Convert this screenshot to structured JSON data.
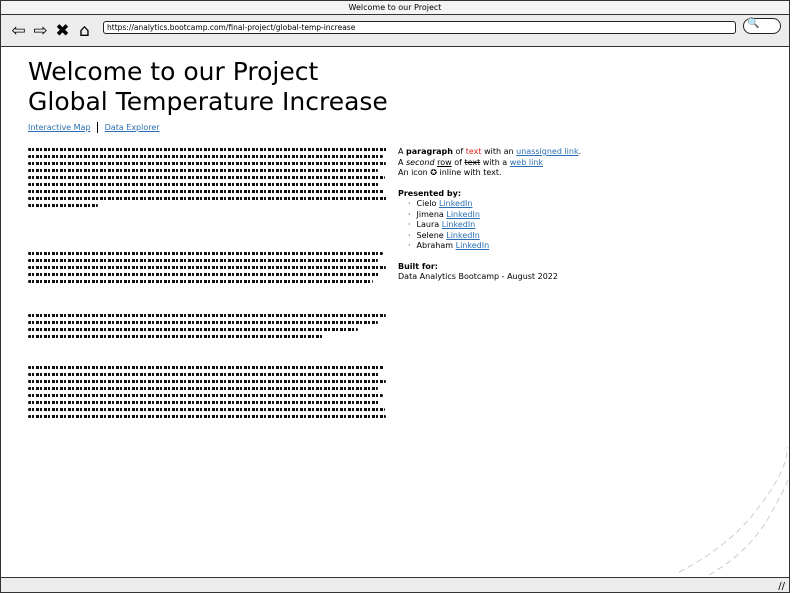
{
  "window": {
    "title": "Welcome to our Project"
  },
  "toolbar": {
    "back_icon": "⇦",
    "forward_icon": "⇨",
    "stop_icon": "✖",
    "home_icon": "⌂",
    "url": "https://analytics.bootcamp.com/final-project/global-temp-increase",
    "search_icon": "🔍"
  },
  "main": {
    "title_line1": "Welcome to our Project",
    "title_line2": "Global Temperature Increase",
    "links": [
      "Interactive Map",
      "Data Explorer"
    ]
  },
  "sidebar": {
    "para_prefix": "A ",
    "para_bold": "paragraph",
    "para_of": " of ",
    "para_red": "text",
    "para_with": " with an ",
    "para_link": "unassigned link",
    "para_end": ".",
    "line2_a": "A ",
    "line2_italic": "second",
    "line2_sp": " ",
    "line2_under": "row",
    "line2_of": " of ",
    "line2_strike": "text",
    "line2_with": " with a ",
    "line2_link": "web link",
    "line3_a": "An icon ",
    "line3_icon": "✪",
    "line3_b": " inline with text.",
    "presented_heading": "Presented by:",
    "presenters": [
      {
        "name": "Cielo",
        "link": "LinkedIn"
      },
      {
        "name": "Jimena",
        "link": "LinkedIn"
      },
      {
        "name": "Laura",
        "link": "LinkedIn"
      },
      {
        "name": "Selene",
        "link": "LinkedIn"
      },
      {
        "name": "Abraham",
        "link": "LinkedIn"
      }
    ],
    "built_heading": "Built for:",
    "built_text": "Data Analytics Bootcamp - August 2022"
  }
}
